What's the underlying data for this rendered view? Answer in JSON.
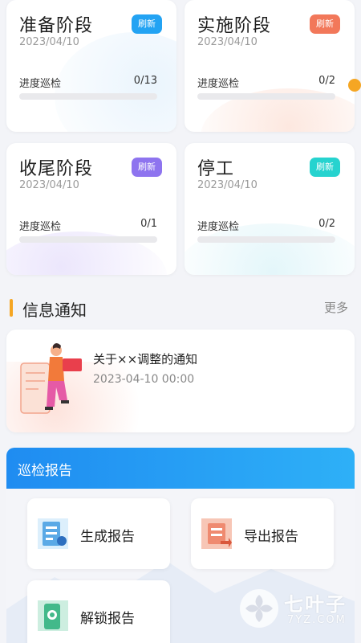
{
  "stages": [
    {
      "title": "准备阶段",
      "date": "2023/04/10",
      "badge": "刷新",
      "badge_color": "#23a3f3",
      "progress_label": "进度巡检",
      "progress_count": "0/13",
      "progress_value": 0
    },
    {
      "title": "实施阶段",
      "date": "2023/04/10",
      "badge": "刷新",
      "badge_color": "#f2785a",
      "progress_label": "进度巡检",
      "progress_count": "0/2",
      "progress_value": 0
    },
    {
      "title": "收尾阶段",
      "date": "2023/04/10",
      "badge": "刷新",
      "badge_color": "#8e74ef",
      "progress_label": "进度巡检",
      "progress_count": "0/1",
      "progress_value": 0
    },
    {
      "title": "停工",
      "date": "2023/04/10",
      "badge": "刷新",
      "badge_color": "#26d3cf",
      "progress_label": "进度巡检",
      "progress_count": "0/2",
      "progress_value": 0
    }
  ],
  "info_section": {
    "title": "信息通知",
    "more": "更多",
    "accent_color": "#f5a623"
  },
  "notice": {
    "title": "关于××调整的通知",
    "time": "2023-04-10 00:00"
  },
  "report_section": {
    "title": "巡检报告",
    "header_color": "#1f8cf1",
    "buttons": [
      {
        "label": "生成报告",
        "icon": "generate-report-icon"
      },
      {
        "label": "导出报告",
        "icon": "export-report-icon"
      },
      {
        "label": "解锁报告",
        "icon": "unlock-report-icon"
      }
    ]
  },
  "watermark": {
    "text": "七叶子",
    "sub": "7YZ.COM"
  }
}
